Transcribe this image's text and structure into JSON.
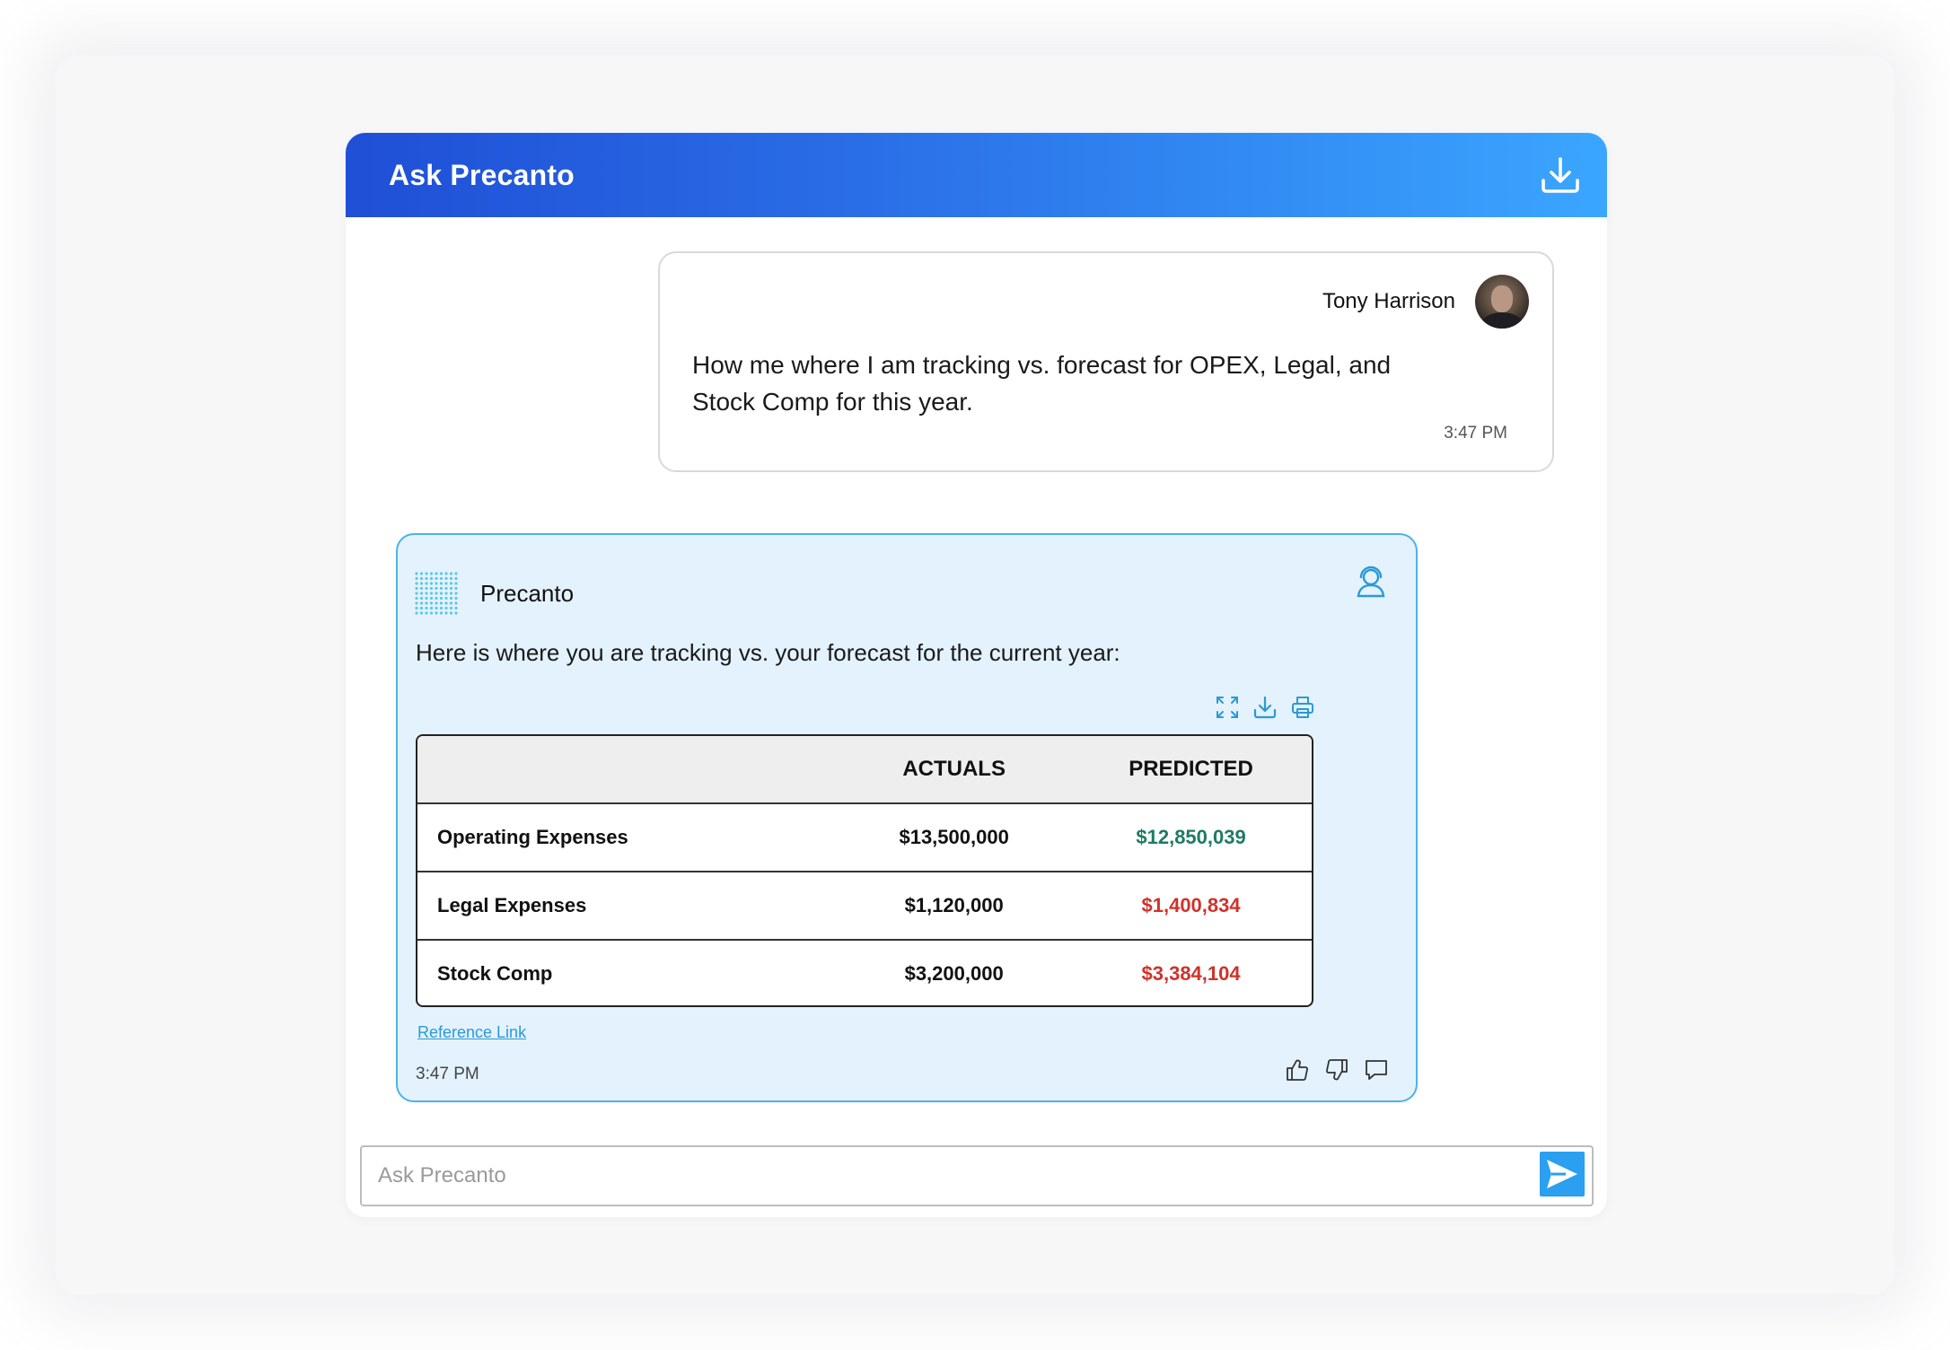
{
  "app": {
    "title": "Ask Precanto",
    "download_icon": "download-icon"
  },
  "user_message": {
    "name": "Tony Harrison",
    "text": "How me where I am tracking vs. forecast for OPEX, Legal, and Stock Comp for this year.",
    "time": "3:47 PM"
  },
  "bot_message": {
    "name": "Precanto",
    "text": "Here is where you are tracking vs. your forecast for the current year:",
    "time": "3:47 PM",
    "reference_link": "Reference Link",
    "table": {
      "headers": [
        "",
        "ACTUALS",
        "PREDICTED"
      ],
      "rows": [
        {
          "label": "Operating Expenses",
          "actual": "$13,500,000",
          "predicted": "$12,850,039",
          "status": "under"
        },
        {
          "label": "Legal Expenses",
          "actual": "$1,120,000",
          "predicted": "$1,400,834",
          "status": "over"
        },
        {
          "label": "Stock Comp",
          "actual": "$3,200,000",
          "predicted": "$3,384,104",
          "status": "over"
        }
      ]
    },
    "tools": [
      "expand-icon",
      "download-icon",
      "print-icon"
    ],
    "feedback": [
      "thumbs-up-icon",
      "thumbs-down-icon",
      "comment-icon"
    ]
  },
  "input": {
    "placeholder": "Ask Precanto"
  },
  "colors": {
    "header_start": "#1f4fd6",
    "header_end": "#3aa6ff",
    "bot_bg": "#e3f2fd",
    "bot_border": "#4db2e6",
    "positive": "#1e7a64",
    "negative": "#d0322a",
    "send": "#2b9ff0"
  }
}
